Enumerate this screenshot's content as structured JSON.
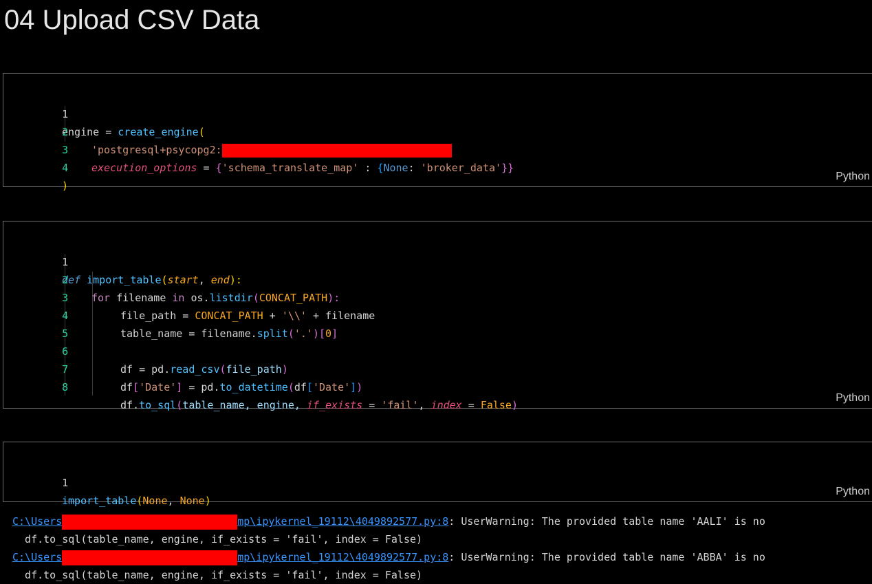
{
  "heading": "04 Upload CSV Data",
  "language_label": "Python",
  "cell1": {
    "line_numbers": [
      "1",
      "2",
      "3",
      "4"
    ],
    "l1_a": "engine = ",
    "l1_b": "create_engine",
    "l1_c": "(",
    "l2_a": "'postgresql+psycopg2:",
    "l3_a": "execution_options",
    "l3_b": " = ",
    "l3_c": "{",
    "l3_d": "'schema_translate_map'",
    "l3_e": " : ",
    "l3_f": "{",
    "l3_g": "None",
    "l3_h": ": ",
    "l3_i": "'broker_data'",
    "l3_j": "}}",
    "l4_a": ")"
  },
  "cell2": {
    "line_numbers": [
      "1",
      "2",
      "3",
      "4",
      "5",
      "6",
      "7",
      "8"
    ],
    "l1_def": "def",
    "l1_fn": "import_table",
    "l1_open": "(",
    "l1_p1": "start",
    "l1_comma": ", ",
    "l1_p2": "end",
    "l1_close": "):",
    "l2_for": "for",
    "l2_a": " filename ",
    "l2_in": "in",
    "l2_b": " os.",
    "l2_fn": "listdir",
    "l2_open": "(",
    "l2_const": "CONCAT_PATH",
    "l2_close": "):",
    "l3_a": "file_path = ",
    "l3_const": "CONCAT_PATH",
    "l3_b": " + ",
    "l3_str": "'\\\\'",
    "l3_c": " + filename",
    "l4_a": "table_name = filename.",
    "l4_fn": "split",
    "l4_open": "(",
    "l4_str": "'.'",
    "l4_close": ")[",
    "l4_num": "0",
    "l4_end": "]",
    "l6_a": "df = pd.",
    "l6_fn": "read_csv",
    "l6_open": "(",
    "l6_arg": "file_path",
    "l6_close": ")",
    "l7_a": "df",
    "l7_b": "[",
    "l7_str": "'Date'",
    "l7_c": "]",
    "l7_d": " = pd.",
    "l7_fn": "to_datetime",
    "l7_open": "(",
    "l7_e": "df",
    "l7_f": "[",
    "l7_str2": "'Date'",
    "l7_g": "]",
    "l7_close": ")",
    "l8_a": "df.",
    "l8_fn": "to_sql",
    "l8_open": "(",
    "l8_b": "table_name, engine, ",
    "l8_p1": "if_exists",
    "l8_c": " = ",
    "l8_str": "'fail'",
    "l8_d": ", ",
    "l8_p2": "index",
    "l8_e": " = ",
    "l8_const": "False",
    "l8_close": ")"
  },
  "cell3": {
    "line_numbers": [
      "1"
    ],
    "l1_fn": "import_table",
    "l1_open": "(",
    "l1_a": "None",
    "l1_b": ", ",
    "l1_c": "None",
    "l1_close": ")"
  },
  "output": {
    "lines": [
      {
        "link_start": "C:\\Users",
        "link_end": "mp\\ipykernel_19112\\4049892577.py:8",
        "message": ": UserWarning: The provided table name 'AALI' is no",
        "code": "  df.to_sql(table_name, engine, if_exists = 'fail', index = False)"
      },
      {
        "link_start": "C:\\Users",
        "link_end": "mp\\ipykernel_19112\\4049892577.py:8",
        "message": ": UserWarning: The provided table name 'ABBA' is no",
        "code": "  df.to_sql(table_name, engine, if_exists = 'fail', index = False)"
      }
    ]
  }
}
